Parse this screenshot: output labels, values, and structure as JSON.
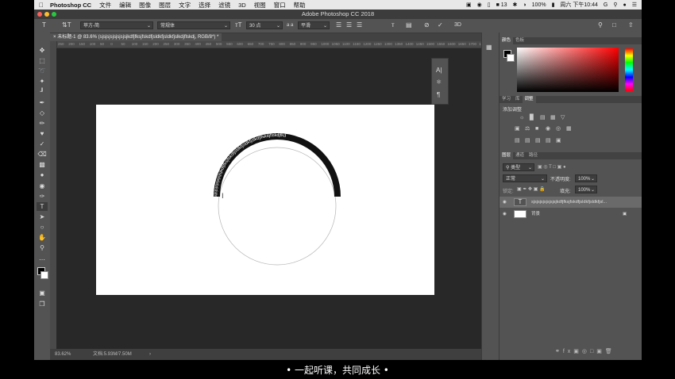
{
  "menubar": {
    "app_name": "Photoshop CC",
    "items": [
      "文件",
      "编辑",
      "图像",
      "图层",
      "文字",
      "选择",
      "滤镜",
      "3D",
      "视图",
      "窗口",
      "帮助"
    ],
    "notification_count": "13",
    "battery": "100%",
    "clock": "周六 下午10:44",
    "g_label": "G"
  },
  "window": {
    "title": "Adobe Photoshop CC 2018"
  },
  "options": {
    "font_family": "苹方-简",
    "font_style": "常规体",
    "font_size": "30 点",
    "antialias_label": "a a",
    "antialias": "平滑",
    "threed_label": "3D"
  },
  "document": {
    "tab_title": "未标题-1 @ 83.6% (sjsjsjsjsjsjsjsjkdfjfksjfskdfjsldkfjsldkfjslkdjflskdj, RGB/8*) *",
    "arc_text": "sjsjsjsjsjsjsjsjkdfjfksjfskdfjsldkfjsldkfjslkdjflskdjflskdjfkd"
  },
  "ruler": {
    "ticks": [
      "250",
      "200",
      "150",
      "100",
      "50",
      "0",
      "50",
      "100",
      "150",
      "200",
      "250",
      "300",
      "350",
      "400",
      "450",
      "500",
      "550",
      "600",
      "650",
      "700",
      "750",
      "800",
      "850",
      "900",
      "950",
      "1000",
      "1050",
      "1100",
      "1150",
      "1200",
      "1250",
      "1300",
      "1350",
      "1400",
      "1450",
      "1500",
      "1550",
      "1600",
      "1650",
      "1700",
      "1750",
      "1800",
      "1850"
    ]
  },
  "status": {
    "zoom": "83.62%",
    "doc_size": "文档:5.93M/7.50M"
  },
  "panels": {
    "color_tabs": [
      "颜色",
      "色板"
    ],
    "adjust_tabs": [
      "学习",
      "库",
      "调整"
    ],
    "adjust_title": "添加调整",
    "layer_tabs": [
      "图层",
      "通道",
      "路径"
    ],
    "kind_label": "类型",
    "blend_mode": "正常",
    "opacity_label": "不透明度:",
    "opacity": "100%",
    "lock_label": "锁定:",
    "fill_label": "填充:",
    "fill": "100%",
    "layers": [
      {
        "name": "sjsjsjsjsjsjsjsjkdfjfksjfskdfjsldkfjsldkfjsl...",
        "type": "text"
      },
      {
        "name": "背景",
        "type": "background"
      }
    ]
  },
  "subtitle": "• 一起听课，共同成长 •"
}
